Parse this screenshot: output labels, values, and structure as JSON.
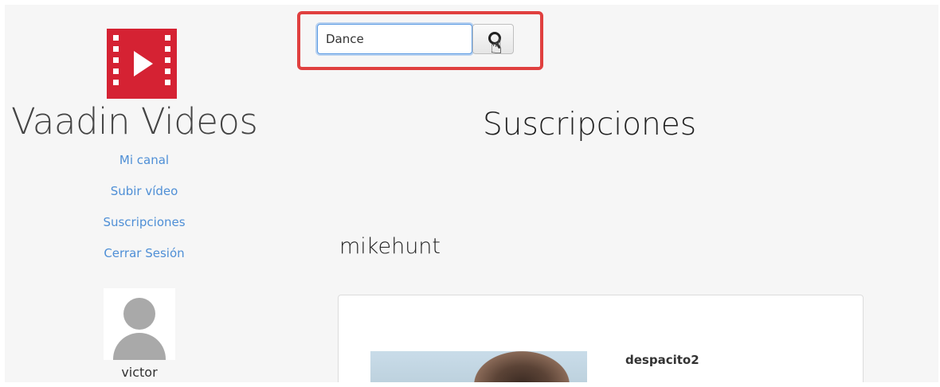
{
  "app": {
    "title": "Vaadin Videos",
    "brand_color": "#d52233"
  },
  "nav": {
    "items": [
      {
        "label": "Mi canal"
      },
      {
        "label": "Subir vídeo"
      },
      {
        "label": "Suscripciones"
      },
      {
        "label": "Cerrar Sesión"
      }
    ]
  },
  "user": {
    "name": "victor",
    "avatar_icon": "user-silhouette-icon"
  },
  "search": {
    "value": "Dance",
    "button_icon": "search-icon",
    "highlight_color": "#e0403f"
  },
  "main": {
    "page_title": "Suscripciones",
    "channels": [
      {
        "name": "mikehunt",
        "videos": [
          {
            "title": "despacito2"
          }
        ]
      }
    ]
  },
  "colors": {
    "link": "#4f8fd6",
    "background": "#f6f6f6"
  }
}
